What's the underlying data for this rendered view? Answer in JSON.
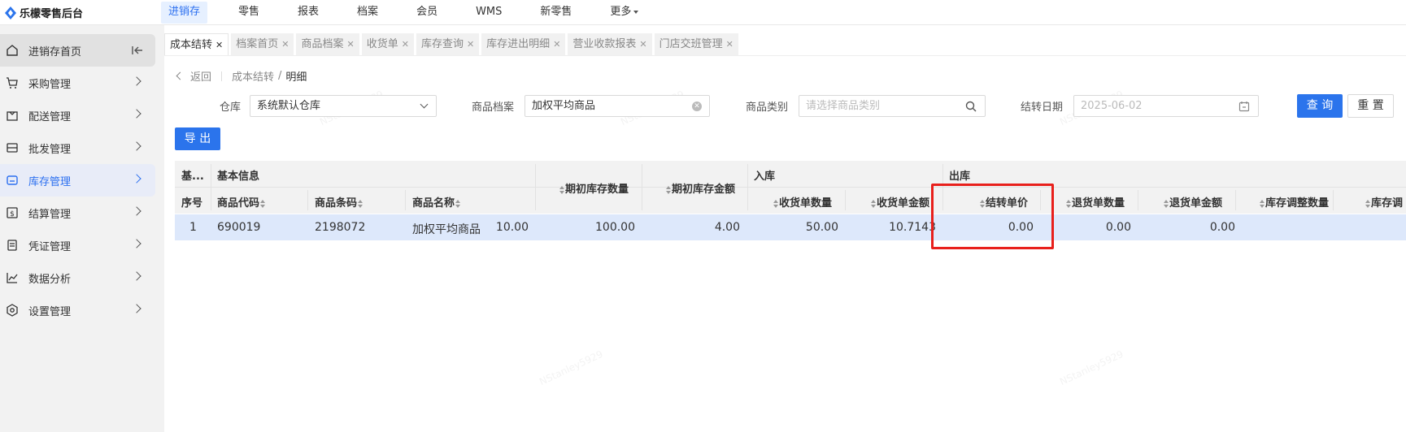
{
  "app": {
    "title": "乐檬零售后台"
  },
  "topnav": {
    "items": [
      "进销存",
      "零售",
      "报表",
      "档案",
      "会员",
      "WMS",
      "新零售",
      "更多"
    ]
  },
  "sidebar": {
    "items": [
      "进销存首页",
      "采购管理",
      "配送管理",
      "批发管理",
      "库存管理",
      "结算管理",
      "凭证管理",
      "数据分析",
      "设置管理"
    ]
  },
  "tabs": [
    "成本结转",
    "档案首页",
    "商品档案",
    "收货单",
    "库存查询",
    "库存进出明细",
    "营业收款报表",
    "门店交班管理"
  ],
  "tab_close": "✕",
  "breadcrumb": {
    "back": "返回",
    "parent": "成本结转",
    "separator": "/",
    "current": "明细"
  },
  "filters": {
    "warehouse_label": "仓库",
    "warehouse_value": "系统默认仓库",
    "product_label": "商品档案",
    "product_value": "加权平均商品",
    "category_label": "商品类别",
    "category_placeholder": "请选择商品类别",
    "date_label": "结转日期",
    "date_value": "2025-06-02"
  },
  "buttons": {
    "query": "查 询",
    "reset": "重 置",
    "export": "导 出"
  },
  "table": {
    "group_headers": {
      "base": "基...",
      "basic_info": "基本信息",
      "inbound": "入库",
      "outbound": "出库"
    },
    "columns": [
      "序号",
      "商品代码",
      "商品条码",
      "商品名称",
      "期初库存数量",
      "期初库存金额",
      "收货单数量",
      "收货单金额",
      "结转单价",
      "退货单数量",
      "退货单金额",
      "库存调整数量",
      "库存调"
    ],
    "rows": [
      [
        "1",
        "690019",
        "2198072",
        "加权平均商品",
        "10.00",
        "100.00",
        "4.00",
        "50.00",
        "10.7143",
        "0.00",
        "0.00",
        "0.00"
      ]
    ]
  },
  "watermark": "NStanley5929",
  "colors": {
    "accent": "#2b74ec",
    "highlight": "#e8201c",
    "row_selected": "#dde8fb"
  }
}
